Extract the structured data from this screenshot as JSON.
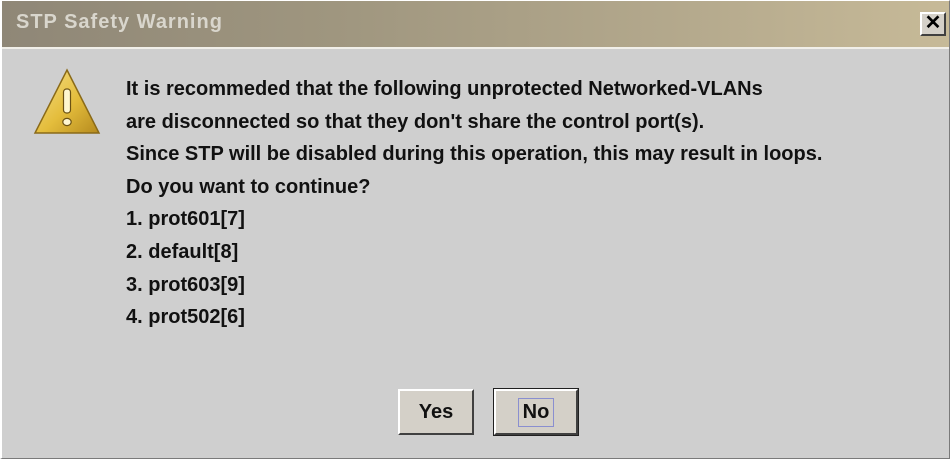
{
  "window": {
    "title": "STP Safety Warning",
    "close_glyph": "✕"
  },
  "icon": "warning-icon",
  "message": {
    "lines": [
      "It is recommeded that the following unprotected Networked-VLANs",
      "are disconnected so that they don't share the control port(s).",
      "Since STP will be disabled during this operation, this may result in loops.",
      "Do you want to continue?",
      "1. prot601[7]",
      "2. default[8]",
      "3. prot603[9]",
      "4. prot502[6]"
    ]
  },
  "buttons": {
    "yes_label": "Yes",
    "no_label": "No",
    "focused": "No"
  },
  "colors": {
    "dialog_bg": "#cfcfcf",
    "titlebar_start": "#8f8777",
    "titlebar_end": "#c7ba98",
    "title_text": "#d9d6cd",
    "icon_yellow": "#e8c44a"
  }
}
